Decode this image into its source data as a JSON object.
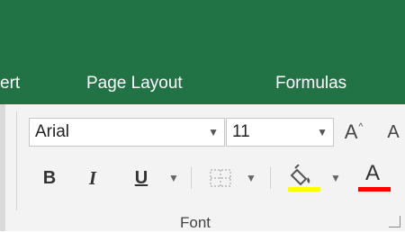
{
  "tabs": {
    "insert_partial": "ert",
    "page_layout": "Page Layout",
    "formulas": "Formulas"
  },
  "font_group": {
    "font_name": "Arial",
    "font_size": "11",
    "label": "Font",
    "grow_font_glyph": "A",
    "shrink_font_glyph": "A",
    "bold_glyph": "B",
    "italic_glyph": "I",
    "underline_glyph": "U",
    "font_color_glyph": "A"
  },
  "colors": {
    "ribbon_green": "#217346",
    "fill_color": "#ffff00",
    "font_color": "#ff0000"
  }
}
